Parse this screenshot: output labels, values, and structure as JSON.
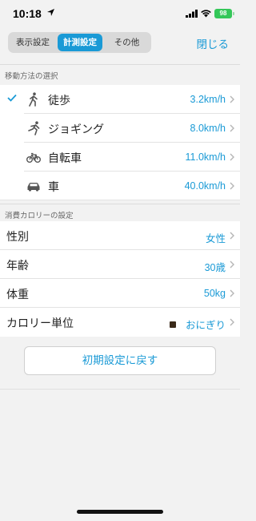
{
  "status_bar": {
    "time": "10:18",
    "battery": "98"
  },
  "nav": {
    "tabs": [
      {
        "label": "表示設定",
        "selected": false
      },
      {
        "label": "計測設定",
        "selected": true
      },
      {
        "label": "その他",
        "selected": false
      }
    ],
    "close_label": "閉じる"
  },
  "movement": {
    "header": "移動方法の選択",
    "items": [
      {
        "label": "徒歩",
        "value": "3.2km/h",
        "selected": true,
        "icon": "walk-icon"
      },
      {
        "label": "ジョギング",
        "value": "8.0km/h",
        "selected": false,
        "icon": "run-icon"
      },
      {
        "label": "自転車",
        "value": "11.0km/h",
        "selected": false,
        "icon": "bicycle-icon"
      },
      {
        "label": "車",
        "value": "40.0km/h",
        "selected": false,
        "icon": "car-icon"
      }
    ]
  },
  "calorie": {
    "header": "消費カロリーの設定",
    "items": [
      {
        "label": "性別",
        "value": "女性"
      },
      {
        "label": "年齢",
        "value": "30歳"
      },
      {
        "label": "体重",
        "value": "50kg"
      },
      {
        "label": "カロリー単位",
        "value": "おにぎり"
      }
    ]
  },
  "reset_label": "初期設定に戻す",
  "colors": {
    "accent": "#1a9ad6",
    "background": "#f2f2f2"
  }
}
